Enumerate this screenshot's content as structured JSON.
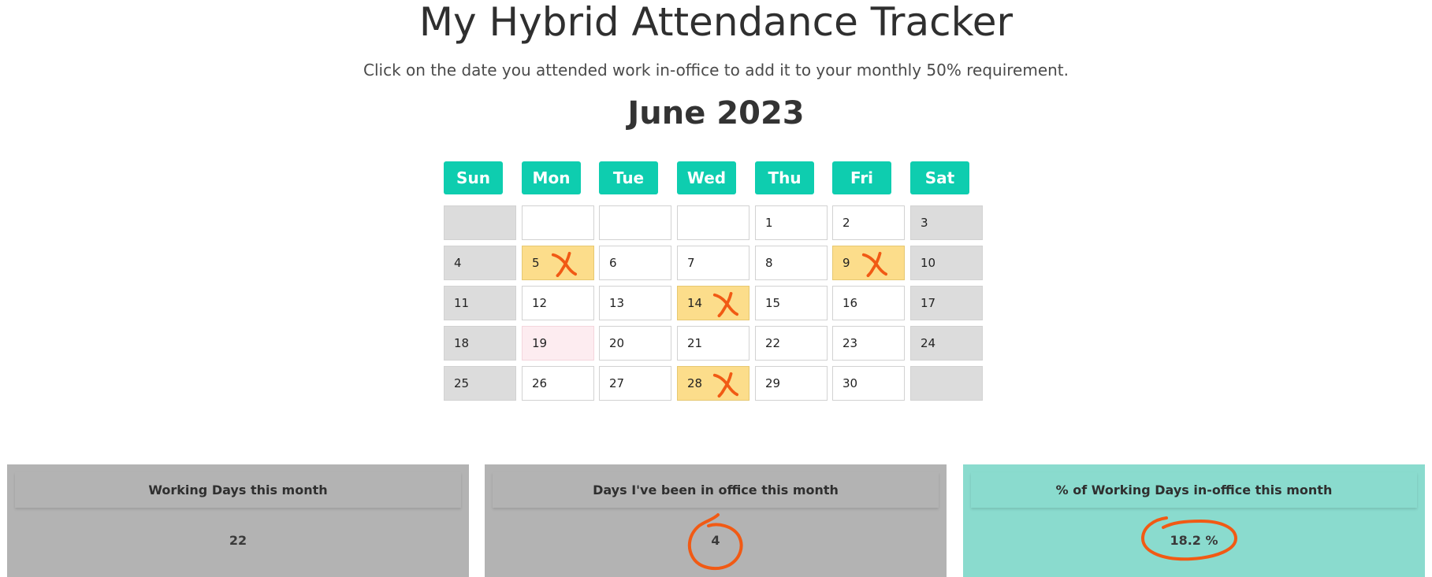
{
  "page": {
    "title": "My Hybrid Attendance Tracker",
    "subtitle": "Click on the date you attended work in-office to add it to your monthly 50% requirement."
  },
  "calendar": {
    "month_label": "June 2023",
    "weekdays": [
      "Sun",
      "Mon",
      "Tue",
      "Wed",
      "Thu",
      "Fri",
      "Sat"
    ],
    "weeks": [
      [
        "",
        "",
        "",
        "",
        "1",
        "2",
        "3"
      ],
      [
        "4",
        "5",
        "6",
        "7",
        "8",
        "9",
        "10"
      ],
      [
        "11",
        "12",
        "13",
        "14",
        "15",
        "16",
        "17"
      ],
      [
        "18",
        "19",
        "20",
        "21",
        "22",
        "23",
        "24"
      ],
      [
        "25",
        "26",
        "27",
        "28",
        "29",
        "30",
        ""
      ]
    ],
    "in_office_days": [
      "5",
      "9",
      "14",
      "28"
    ],
    "highlighted_day": "19",
    "colors": {
      "weekday_header": "#0ecdaf",
      "in_office": "#fcdd8b",
      "weekend": "#dcdcdc",
      "highlighted": "#fdecf0",
      "annotation": "#f15a14"
    }
  },
  "stats": {
    "working_days": {
      "label": "Working Days this month",
      "value": "22"
    },
    "office_days": {
      "label": "Days I've been in office this month",
      "value": "4"
    },
    "percent_office": {
      "label": "% of Working Days in-office this month",
      "value": "18.2 %"
    }
  }
}
